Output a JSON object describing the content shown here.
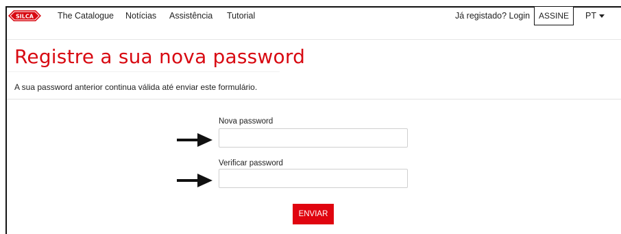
{
  "brand": {
    "logo_text": "SILCA",
    "accent_color": "#d80a12"
  },
  "nav": {
    "links": [
      "The Catalogue",
      "Notícias",
      "Assistência",
      "Tutorial"
    ],
    "login_label": "Já registado? Login",
    "subscribe_label": "ASSINE",
    "language": "PT"
  },
  "page": {
    "title": "Registre a sua nova password",
    "subtitle": "A sua password anterior continua válida até enviar este formulário."
  },
  "form": {
    "new_password_label": "Nova password",
    "new_password_value": "",
    "verify_password_label": "Verificar password",
    "verify_password_value": "",
    "submit_label": "ENVIAR",
    "submit_color": "#e0040f"
  }
}
